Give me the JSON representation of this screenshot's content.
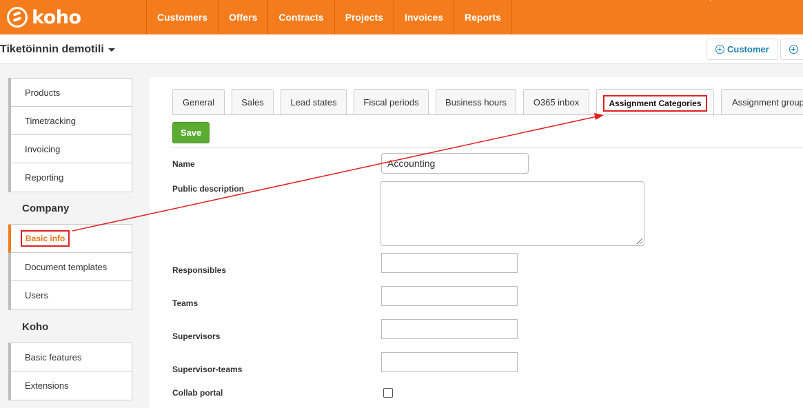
{
  "brand": {
    "name": "koho"
  },
  "nav": [
    "Customers",
    "Offers",
    "Contracts",
    "Projects",
    "Invoices",
    "Reports"
  ],
  "subheader": {
    "account": "Tiketöinnin demotili",
    "customer_button": "Customer"
  },
  "sidebar": {
    "group1": [
      "Products",
      "Timetracking",
      "Invoicing",
      "Reporting"
    ],
    "company_heading": "Company",
    "group2": [
      "Basic info",
      "Document templates",
      "Users"
    ],
    "koho_heading": "Koho",
    "group3": [
      "Basic features",
      "Extensions"
    ]
  },
  "tabs": [
    "General",
    "Sales",
    "Lead states",
    "Fiscal periods",
    "Business hours",
    "O365 inbox",
    "Assignment Categories",
    "Assignment group"
  ],
  "active_tab": "Assignment Categories",
  "form": {
    "save_label": "Save",
    "name_label": "Name",
    "name_value": "Accounting",
    "public_description_label": "Public description",
    "responsibles_label": "Responsibles",
    "teams_label": "Teams",
    "supervisors_label": "Supervisors",
    "supervisor_teams_label": "Supervisor-teams",
    "collab_portal_label": "Collab portal",
    "collab_portal_checked": false
  },
  "colors": {
    "brand": "#f57c1c",
    "save": "#5cab32",
    "link": "#1a7fb5",
    "annotation": "#e02020"
  }
}
